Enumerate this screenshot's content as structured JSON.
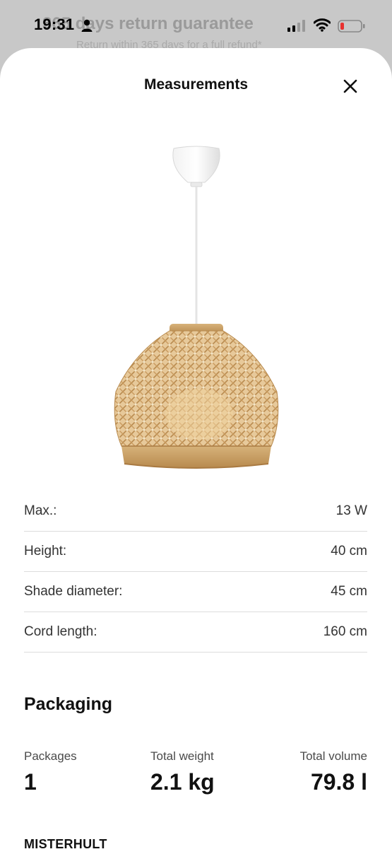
{
  "status_bar": {
    "time": "19:31"
  },
  "background": {
    "title": "365 days return guarantee",
    "subtitle": "Return within 365 days for a full refund*"
  },
  "sheet": {
    "title": "Measurements",
    "close_icon": "close-icon"
  },
  "specs": [
    {
      "label": "Max.:",
      "value": "13 W"
    },
    {
      "label": "Height:",
      "value": "40 cm"
    },
    {
      "label": "Shade diameter:",
      "value": "45 cm"
    },
    {
      "label": "Cord length:",
      "value": "160 cm"
    }
  ],
  "packaging": {
    "heading": "Packaging",
    "packages_label": "Packages",
    "packages_value": "1",
    "weight_label": "Total weight",
    "weight_value": "2.1 kg",
    "volume_label": "Total volume",
    "volume_value": "79.8 l"
  },
  "next_section_label": "MISTERHULT",
  "colors": {
    "sheet": "#ffffff",
    "backdrop": "#c8c8c8",
    "battery_low": "#e8312f"
  }
}
